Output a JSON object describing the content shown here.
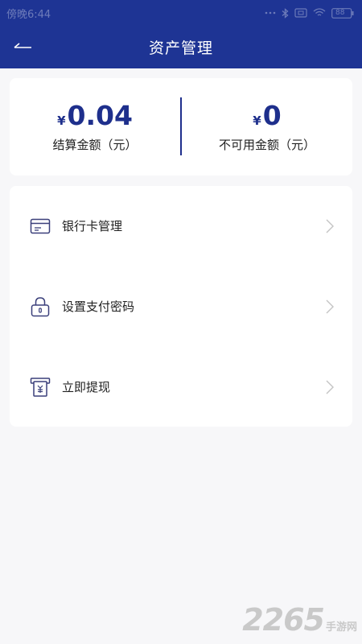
{
  "status_bar": {
    "time": "傍晚6:44",
    "battery": "88"
  },
  "header": {
    "title": "资产管理",
    "back_icon": "arrow-left-icon"
  },
  "balances": [
    {
      "currency": "¥",
      "amount": "0.04",
      "label": "结算金额（元）"
    },
    {
      "currency": "¥",
      "amount": "0",
      "label": "不可用金额（元）"
    }
  ],
  "menu": {
    "items": [
      {
        "label": "银行卡管理",
        "icon": "bank-card-icon"
      },
      {
        "label": "设置支付密码",
        "icon": "lock-icon"
      },
      {
        "label": "立即提现",
        "icon": "withdraw-icon"
      }
    ]
  },
  "watermark": {
    "number": "2265",
    "text": "手游网"
  },
  "colors": {
    "primary": "#1e3494",
    "amount": "#1e2f8c",
    "background": "#f7f7f9"
  }
}
